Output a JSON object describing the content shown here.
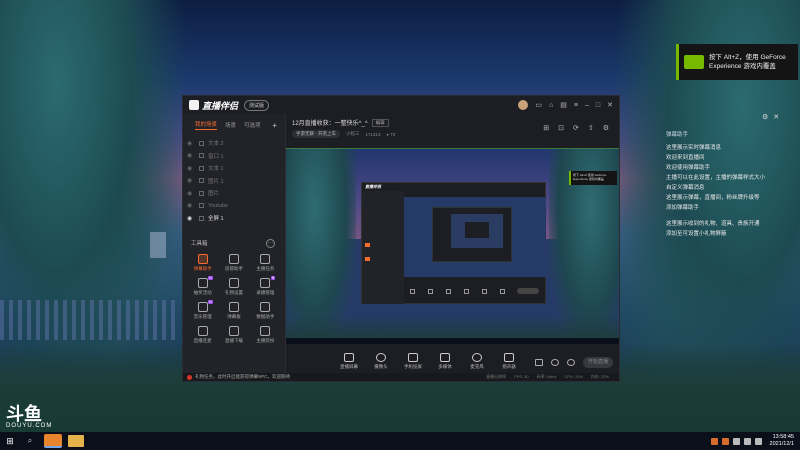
{
  "desktop": {
    "logo_big": "斗鱼",
    "logo_small": "DOUYU.COM"
  },
  "nvidia_notice": {
    "line1": "按下 Alt+Z，使用 GeForce",
    "line2": "Experience 游戏内覆盖"
  },
  "overlay_chat": {
    "header": "弹幕助手",
    "rows": [
      "这里展示实时弹幕消息",
      "欢迎来到直播间",
      "欢迎使用弹幕助手",
      "主播可以在此设置，主播的弹幕样式大小",
      "自定义弹幕消息",
      "这里展示弹幕，直播间，粉丝牌升级等",
      "添加弹幕助手",
      "这里展示收到的礼物、道具、贵族开通",
      "添加至可设置小礼物屏蔽"
    ]
  },
  "taskbar": {
    "time": "13:58:45",
    "date": "2021/12/1"
  },
  "app": {
    "name": "直播伴侣",
    "version_badge": "测试版",
    "sidebar": {
      "tabs": [
        "我的场景",
        "场景",
        "可选项"
      ],
      "plus": "+",
      "scenes": [
        {
          "label": "文本 2",
          "on": false
        },
        {
          "label": "窗口 1",
          "on": false
        },
        {
          "label": "文本 1",
          "on": false
        },
        {
          "label": "图片 1",
          "on": false
        },
        {
          "label": "图片",
          "on": false
        },
        {
          "label": "Youtube",
          "on": false
        },
        {
          "label": "全屏 1",
          "on": true
        }
      ],
      "tools_header": "工具箱",
      "tools": [
        {
          "label": "弹幕助手",
          "selected": true,
          "new": false
        },
        {
          "label": "房管助手",
          "selected": false,
          "new": false
        },
        {
          "label": "主播任务",
          "selected": false,
          "new": false
        },
        {
          "label": "抽奖活动",
          "selected": false,
          "new": true
        },
        {
          "label": "礼物设置",
          "selected": false,
          "new": false
        },
        {
          "label": "录播管理",
          "selected": false,
          "new": true
        },
        {
          "label": "音乐管理",
          "selected": false,
          "new": true
        },
        {
          "label": "弹幕板",
          "selected": false,
          "new": false
        },
        {
          "label": "数据助手",
          "selected": false,
          "new": false
        },
        {
          "label": "直播连麦",
          "selected": false,
          "new": false
        },
        {
          "label": "直播下载",
          "selected": false,
          "new": false
        },
        {
          "label": "主播装扮",
          "selected": false,
          "new": false
        }
      ]
    },
    "room": {
      "title": "12月直播收获：一整快乐^_^",
      "edit": "编辑",
      "category": "手游无聊 - 开黑上车",
      "id_label": "小程三",
      "id_value": "171313",
      "fans": "73"
    },
    "nested_notice": "按下 Alt+Z 使用 GeForce Experience 游戏内覆盖",
    "nested_app_name": "直播伴侣",
    "controls": [
      {
        "label": "直播屏幕"
      },
      {
        "label": "摄像头"
      },
      {
        "label": "手机投屏"
      },
      {
        "label": "多媒体"
      },
      {
        "label": "麦克风"
      },
      {
        "label": "扬声器"
      }
    ],
    "go_live": "开始直播",
    "status": {
      "message": "礼物任务，此时开启能获得弹幕NPC，欢迎期待",
      "stats": [
        "直播分辨率",
        "FPS: 30",
        "码率: 0kb/s",
        "CPU: 11%",
        "内存: 22%"
      ]
    }
  }
}
